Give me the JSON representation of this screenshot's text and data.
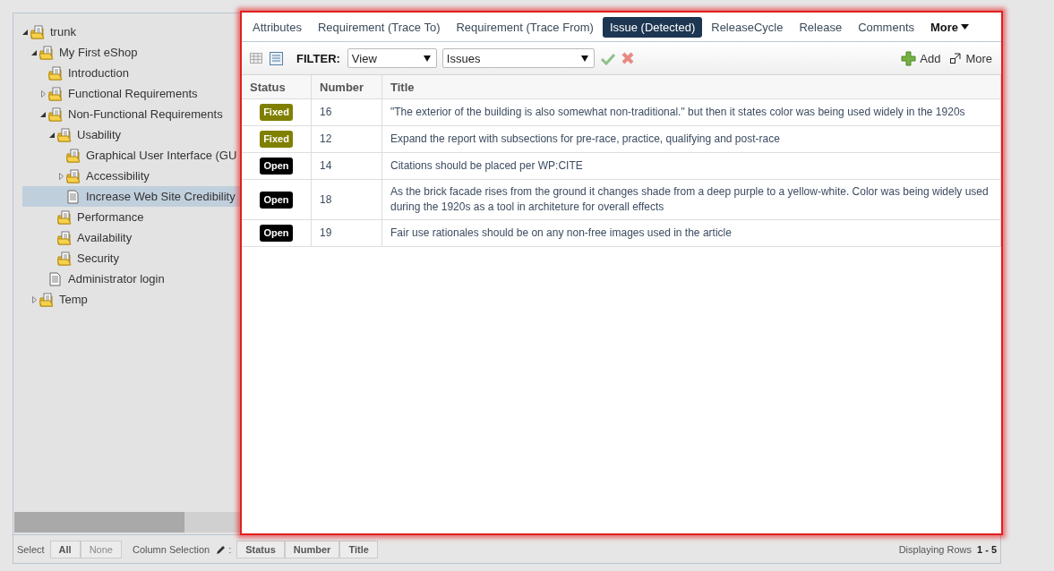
{
  "tree": [
    {
      "label": "trunk",
      "kind": "folder",
      "expanded": true,
      "selected": false,
      "children": [
        {
          "label": "My First eShop",
          "kind": "folder",
          "expanded": true,
          "selected": false,
          "children": [
            {
              "label": "Introduction",
              "kind": "folder",
              "selected": false
            },
            {
              "label": "Functional Requirements",
              "kind": "folder",
              "expanded": false,
              "selected": false
            },
            {
              "label": "Non-Functional Requirements",
              "kind": "folder",
              "expanded": true,
              "selected": false,
              "children": [
                {
                  "label": "Usability",
                  "kind": "folder",
                  "expanded": true,
                  "selected": false,
                  "children": [
                    {
                      "label": "Graphical User Interface (GU",
                      "kind": "folder",
                      "selected": false
                    },
                    {
                      "label": "Accessibility",
                      "kind": "folder",
                      "expanded": false,
                      "selected": false
                    },
                    {
                      "label": "Increase Web Site Credibility",
                      "kind": "document",
                      "selected": true
                    }
                  ]
                },
                {
                  "label": "Performance",
                  "kind": "folder",
                  "selected": false
                },
                {
                  "label": "Availability",
                  "kind": "folder",
                  "selected": false
                },
                {
                  "label": "Security",
                  "kind": "folder",
                  "selected": false
                }
              ]
            },
            {
              "label": "Administrator login",
              "kind": "document",
              "selected": false
            }
          ]
        },
        {
          "label": "Temp",
          "kind": "folder",
          "expanded": false,
          "selected": false
        }
      ]
    }
  ],
  "tabs": [
    {
      "label": "Attributes",
      "selected": false
    },
    {
      "label": "Requirement (Trace To)",
      "selected": false
    },
    {
      "label": "Requirement (Trace From)",
      "selected": false
    },
    {
      "label": "Issue (Detected)",
      "selected": true
    },
    {
      "label": "ReleaseCycle",
      "selected": false
    },
    {
      "label": "Release",
      "selected": false
    },
    {
      "label": "Comments",
      "selected": false
    },
    {
      "label": "More",
      "selected": false,
      "kind": "more"
    }
  ],
  "toolbar": {
    "filter_label": "FILTER:",
    "view_select": "View",
    "issues_select": "Issues",
    "add": "Add",
    "more": "More"
  },
  "table": {
    "columns": [
      "Status",
      "Number",
      "Title"
    ],
    "rows": [
      {
        "status": "Fixed",
        "color": "#7f7f00",
        "number": "16",
        "title": "\"The exterior of the building is also somewhat non-traditional.\" but then it states color was being used widely in the 1920s"
      },
      {
        "status": "Fixed",
        "color": "#7f7f00",
        "number": "12",
        "title": "Expand the report with subsections for pre-race, practice, qualifying and post-race"
      },
      {
        "status": "Open",
        "color": "#000000",
        "number": "14",
        "title": "Citations should be placed per WP:CITE"
      },
      {
        "status": "Open",
        "color": "#000000",
        "number": "18",
        "title": "As the brick facade rises from the ground it changes shade from a deep purple to a yellow-white. Color was being widely used during the 1920s as a tool in architeture for overall effects"
      },
      {
        "status": "Open",
        "color": "#000000",
        "number": "19",
        "title": "Fair use rationales should be on any non-free images used in the article"
      }
    ]
  },
  "footer": {
    "select_label": "Select",
    "select_buttons": [
      {
        "label": "All",
        "disabled": false
      },
      {
        "label": "None",
        "disabled": true
      }
    ],
    "column_label": "Column Selection",
    "column_separator": ":",
    "column_buttons": [
      "Status",
      "Number",
      "Title"
    ],
    "rows_label": "Displaying Rows",
    "rows_range": "1 - 5"
  }
}
